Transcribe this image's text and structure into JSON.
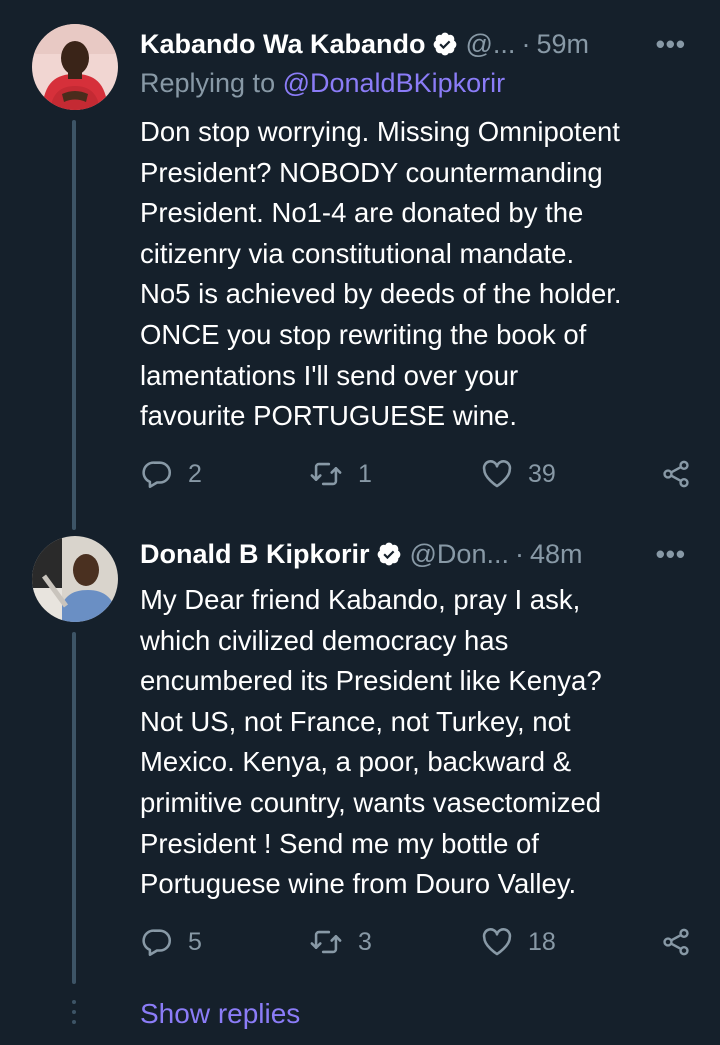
{
  "tweets": [
    {
      "name": "Kabando Wa Kabando",
      "handle": "@...",
      "dot": "·",
      "time": "59m",
      "more": "•••",
      "replying_prefix": "Replying to ",
      "replying_mention": "@DonaldBKipkorir",
      "body_lines": [
        "Don stop worrying. Missing Omnipotent",
        "President? NOBODY countermanding",
        "President. No1-4 are donated by the",
        "citizenry via constitutional mandate.",
        "No5 is achieved by deeds of the holder.",
        "ONCE you stop rewriting the book of",
        "lamentations I'll send over your",
        "favourite PORTUGUESE wine."
      ],
      "replies": "2",
      "retweets": "1",
      "likes": "39"
    },
    {
      "name": "Donald B Kipkorir",
      "handle": "@Don...",
      "dot": "·",
      "time": "48m",
      "more": "•••",
      "body_lines": [
        "My Dear friend Kabando, pray I ask,",
        "which civilized democracy has",
        "encumbered its President like Kenya?",
        "Not US, not France, not Turkey, not",
        "Mexico. Kenya, a poor, backward &",
        "primitive country, wants vasectomized",
        "President ! Send me my bottle of",
        "Portuguese wine from Douro Valley."
      ],
      "replies": "5",
      "retweets": "3",
      "likes": "18"
    }
  ],
  "show_replies": "Show replies",
  "colors": {
    "background": "#15202b",
    "text": "#ffffff",
    "secondary": "#8899a6",
    "accent": "#8b7cf7",
    "thread_line": "#3d5466"
  },
  "icons": [
    "verified-icon",
    "reply-icon",
    "retweet-icon",
    "like-icon",
    "share-icon",
    "more-icon"
  ]
}
